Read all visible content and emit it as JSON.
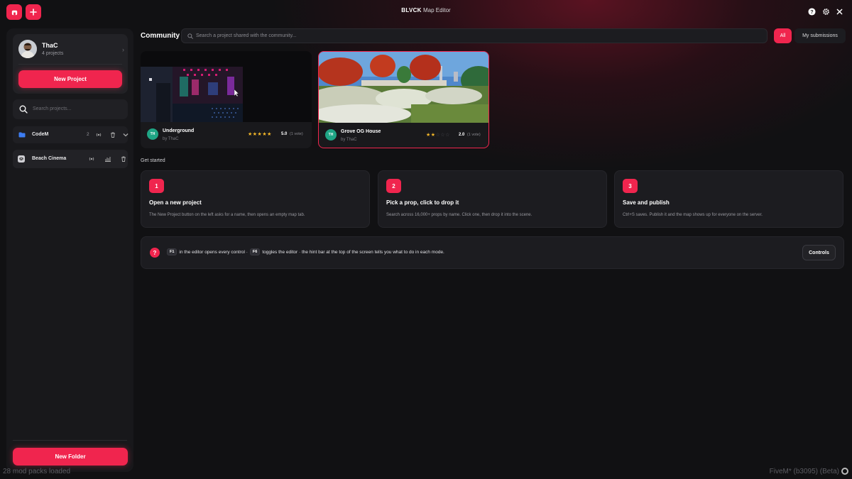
{
  "app": {
    "brand": "BLVCK",
    "title": "Map Editor"
  },
  "colors": {
    "accent": "#f0254e",
    "badge": "#1fa585",
    "star": "#f5b829"
  },
  "topbar": {
    "left_icons": [
      "home-icon",
      "plus-icon"
    ],
    "right_icons": [
      "help-icon",
      "gear-icon",
      "close-icon"
    ]
  },
  "profile": {
    "name": "ThaC",
    "count": "4 projects"
  },
  "sidebar": {
    "new_project_label": "New Project",
    "search_placeholder": "Search projects...",
    "folders": [
      {
        "name": "CodeM",
        "count": "2",
        "icon": "folder-icon",
        "expandable": true
      },
      {
        "name": "Beach Cinema",
        "count": "",
        "icon": "map-icon",
        "expandable": false
      }
    ],
    "new_folder_label": "New Folder"
  },
  "community": {
    "title": "Community",
    "search_placeholder": "Search a project shared with the community...",
    "filter_all": "All",
    "filter_mine": "My submissions",
    "cards": [
      {
        "initials": "TH",
        "name": "Underground",
        "author": "by ThaC",
        "rating_value": 5,
        "rating": "5.0",
        "votes": "(1 vote)"
      },
      {
        "initials": "TH",
        "name": "Grove OG House",
        "author": "by ThaC",
        "rating_value": 2,
        "rating": "2.0",
        "votes": "(1 vote)"
      }
    ]
  },
  "get_started": {
    "label": "Get started",
    "steps": [
      {
        "num": "1",
        "title": "Open a new project",
        "desc": "The New Project button on the left asks for a name, then opens an empty map tab."
      },
      {
        "num": "2",
        "title": "Pick a prop, click to drop it",
        "desc": "Search across 16,000+ props by name. Click one, then drop it into the scene."
      },
      {
        "num": "3",
        "title": "Save and publish",
        "desc": "Ctrl+S saves. Publish it and the map shows up for everyone on the server."
      }
    ]
  },
  "hint": {
    "key1": "F1",
    "text1": "in the editor opens every control ·",
    "key2": "F6",
    "text2": "toggles the editor · the hint bar at the top of the screen tells you what to do in each mode.",
    "button": "Controls"
  },
  "status": {
    "left": "28 mod packs loaded",
    "right": "FiveM* (b3095) (Beta)"
  }
}
